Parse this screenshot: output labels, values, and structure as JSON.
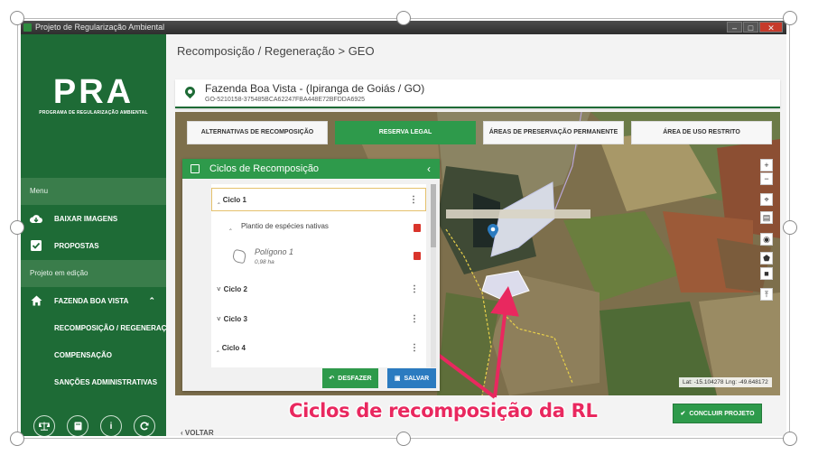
{
  "window": {
    "title": "Projeto de Regularização Ambiental",
    "controls": [
      "–",
      "□",
      "✕"
    ]
  },
  "logo": {
    "acronym": "PRA",
    "full": "PROGRAMA DE REGULARIZAÇÃO AMBIENTAL"
  },
  "sidebar": {
    "menu_label": "Menu",
    "items": [
      {
        "label": "BAIXAR IMAGENS",
        "icon": "cloud-download-icon"
      },
      {
        "label": "PROPOSTAS",
        "icon": "checkbox-icon"
      }
    ],
    "project_label": "Projeto em edição",
    "project": {
      "label": "FAZENDA BOA VISTA",
      "icon": "home-icon"
    },
    "subitems": [
      {
        "label": "RECOMPOSIÇÃO / REGENERAÇÃO"
      },
      {
        "label": "COMPENSAÇÃO"
      },
      {
        "label": "SANÇÕES ADMINISTRATIVAS"
      }
    ],
    "footer_icons": [
      "scale-icon",
      "book-icon",
      "info-icon",
      "refresh-icon"
    ]
  },
  "header": {
    "breadcrumb": "Recomposição / Regeneração > GEO"
  },
  "farm": {
    "name": "Fazenda Boa Vista - (Ipiranga de Goiás / GO)",
    "code": "GO-5210158-375485BCA62247FBA448E72BFDDA6925"
  },
  "tabs": [
    {
      "label": "ALTERNATIVAS DE RECOMPOSIÇÃO",
      "active": false
    },
    {
      "label": "RESERVA LEGAL",
      "active": true
    },
    {
      "label": "ÁREAS DE PRESERVAÇÃO PERMANENTE",
      "active": false
    },
    {
      "label": "ÁREA DE USO RESTRITO",
      "active": false
    }
  ],
  "panel": {
    "title": "Ciclos de Recomposição",
    "cycles": [
      {
        "label": "Ciclo 1",
        "expanded": true
      },
      {
        "label": "Ciclo 2",
        "expanded": false
      },
      {
        "label": "Ciclo 3",
        "expanded": false
      },
      {
        "label": "Ciclo 4",
        "expanded": true
      }
    ],
    "method": "Plantio de espécies nativas",
    "polygon": {
      "name": "Polígono 1",
      "area": "0,98 ha"
    },
    "undo_label": "DESFAZER",
    "save_label": "SALVAR"
  },
  "map": {
    "zoom_in": "+",
    "zoom_out": "−",
    "coords": "Lat: -15.104278 Lng: -49.648172"
  },
  "footer": {
    "back_label": "VOLTAR",
    "finish_label": "CONCLUIR PROJETO"
  },
  "annotation": {
    "text": "Ciclos de recomposição da RL",
    "color": "#e9285f"
  },
  "colors": {
    "brand_green": "#1e6b36",
    "accent_green": "#2e9a4b",
    "save_blue": "#2b7bc0",
    "delete_red": "#d9342b"
  }
}
